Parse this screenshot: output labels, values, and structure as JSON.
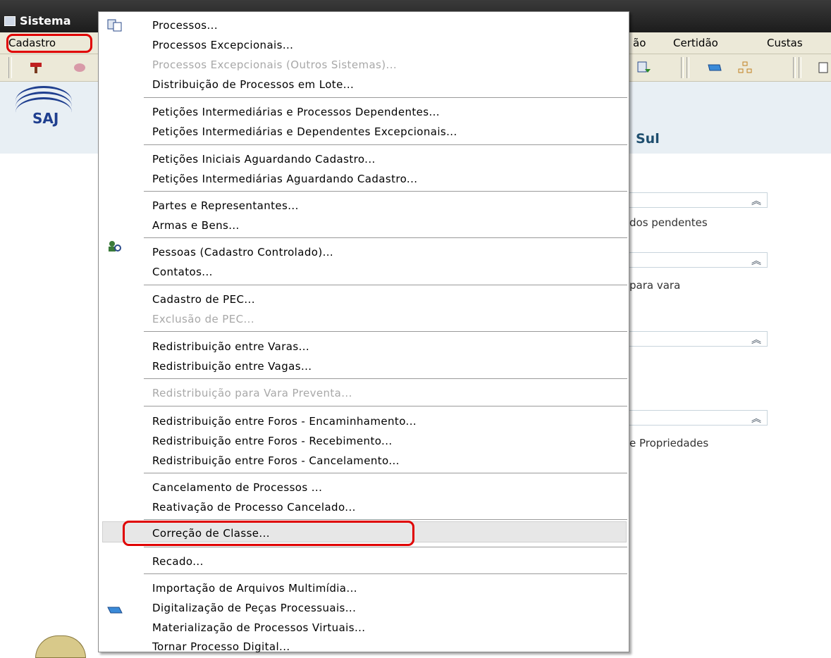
{
  "window": {
    "title": "Sistema"
  },
  "menubar": {
    "items": [
      "Cadastro",
      "ão",
      "Certidão",
      "Custas"
    ]
  },
  "logo": {
    "text": "SAJ"
  },
  "background": {
    "heading": "Sul",
    "texts": [
      "dos pendentes",
      "para vara",
      "e Propriedades"
    ]
  },
  "menu": {
    "items": [
      "Processos...",
      "Processos Excepcionais...",
      "Processos Excepcionais (Outros Sistemas)...",
      "Distribuição de Processos em Lote...",
      "Petições Intermediárias e Processos Dependentes...",
      "Petições Intermediárias e Dependentes Excepcionais...",
      "Petições Iniciais Aguardando Cadastro...",
      "Petições Intermediárias Aguardando Cadastro...",
      "Partes e Representantes...",
      "Armas e Bens...",
      "Pessoas (Cadastro Controlado)...",
      "Contatos...",
      "Cadastro de PEC...",
      "Exclusão de PEC...",
      "Redistribuição entre Varas...",
      "Redistribuição entre Vagas...",
      "Redistribuição para Vara Preventa...",
      "Redistribuição entre Foros - Encaminhamento...",
      "Redistribuição entre Foros - Recebimento...",
      "Redistribuição entre Foros - Cancelamento...",
      "Cancelamento de Processos ...",
      "Reativação de Processo Cancelado...",
      "Correção de Classe...",
      "Recado...",
      "Importação de Arquivos Multimídia...",
      "Digitalização de Peças Processuais...",
      "Materialização de Processos Virtuais...",
      "Tornar Processo Digital..."
    ],
    "disabled_items": [
      "Processos Excepcionais (Outros Sistemas)...",
      "Exclusão de PEC...",
      "Redistribuição para Vara Preventa..."
    ],
    "highlighted_item": "Correção de Classe...",
    "icons": {
      "processos": "process-document-icon",
      "pessoas": "person-search-icon",
      "digitalizacao": "scanner-icon"
    }
  },
  "colors": {
    "annotation_outline": "#e00000",
    "menu_highlight": "#e7e7e7",
    "disabled_text": "#a8a8a8",
    "titlebar": "#2a2a2a",
    "menubar_bg": "#ece9d8"
  }
}
